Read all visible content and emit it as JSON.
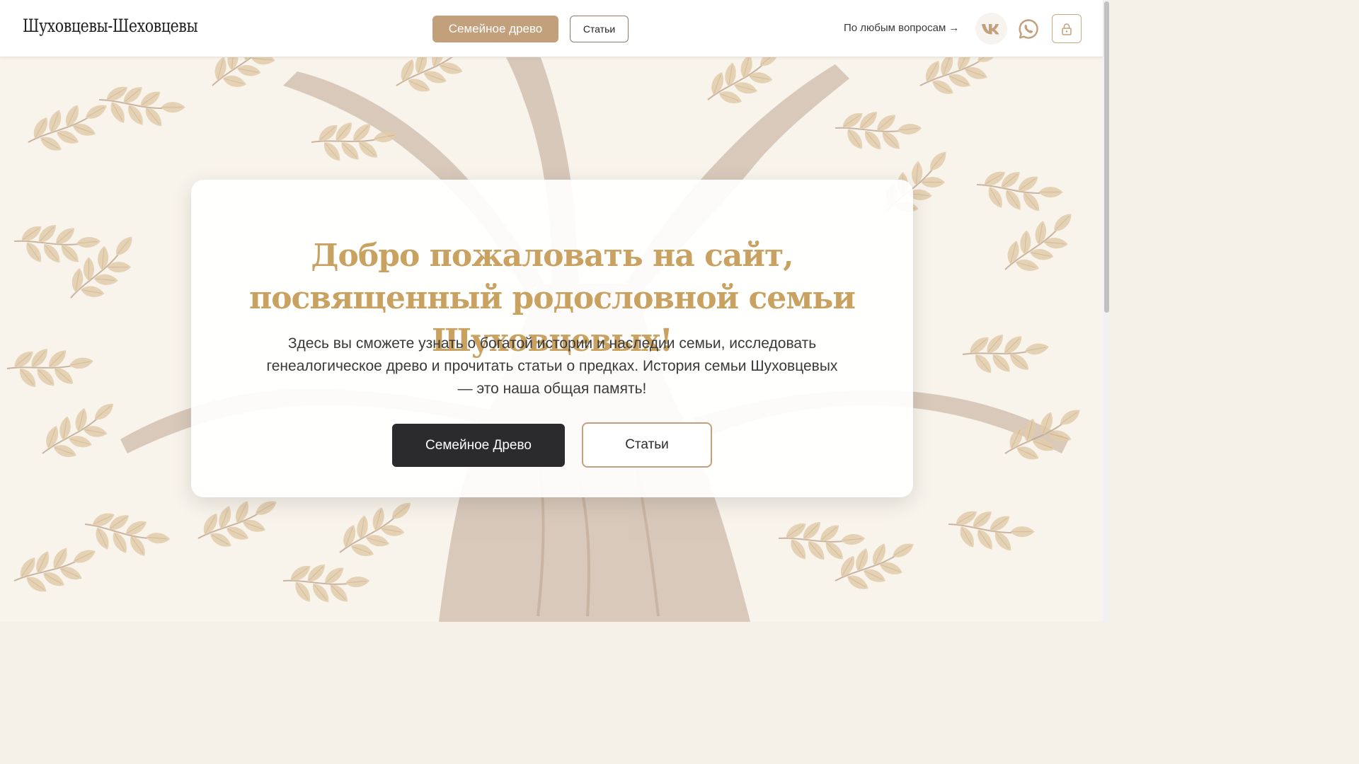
{
  "header": {
    "logo": "Шуховцевы-Шеховцевы",
    "nav_primary": "Семейное древо",
    "nav_secondary": "Статьи",
    "contact_text": "По любым вопросам →",
    "icons": [
      "vk-icon",
      "whatsapp-icon",
      "lock-icon"
    ]
  },
  "hero": {
    "title": "Добро пожаловать на сайт, посвященный родословной семьи Шуховцевых!",
    "text": "Здесь вы сможете узнать о богатой истории и наследии семьи, исследовать генеалогическое древо и прочитать статьи о предках. История семьи Шуховцевых — это наша общая память!",
    "cta_primary": "Семейное Древо",
    "cta_secondary": "Статьи"
  },
  "colors": {
    "accent": "#c2a07c",
    "title_gold": "#c9a262",
    "dark_button": "#2b2b2d",
    "background": "#f6f1e8"
  }
}
